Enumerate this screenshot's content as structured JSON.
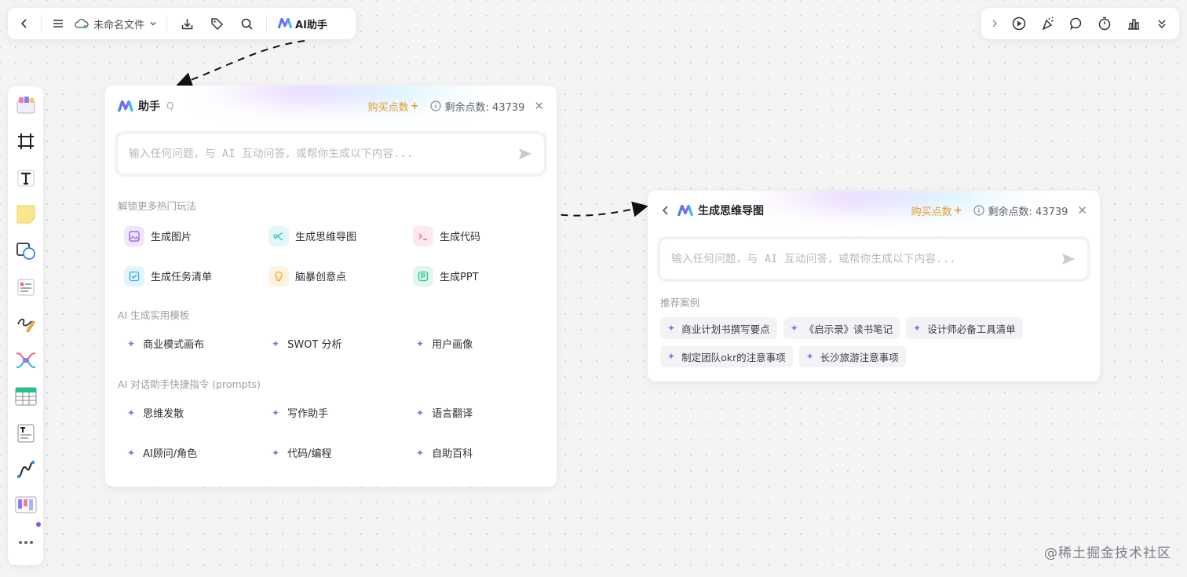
{
  "topbar": {
    "filename": "未命名文件",
    "ai_label": "AI助手"
  },
  "colors": {
    "accent": "#7b5cf0",
    "buy": "#e29a2e",
    "mindmap": "#1fc5c5",
    "code": "#f06292",
    "todo": "#2ab0e8",
    "idea": "#f5a623",
    "ppt": "#22c58b",
    "image": "#9b6bf2"
  },
  "assistant": {
    "title": "助手",
    "q": "Q",
    "buy": "购买点数",
    "points_label": "剩余点数: 43739",
    "placeholder": "输入任何问题，与 AI 互动问答，或帮你生成以下内容...",
    "section_unlock": "解锁更多热门玩法",
    "features": [
      {
        "label": "生成图片",
        "icon": "image-icon"
      },
      {
        "label": "生成思维导图",
        "icon": "mindmap-icon"
      },
      {
        "label": "生成代码",
        "icon": "code-icon"
      },
      {
        "label": "生成任务清单",
        "icon": "checklist-icon"
      },
      {
        "label": "脑暴创意点",
        "icon": "bulb-icon"
      },
      {
        "label": "生成PPT",
        "icon": "ppt-icon"
      }
    ],
    "section_templates": "AI 生成实用模板",
    "templates": [
      "商业模式画布",
      "SWOT 分析",
      "用户画像"
    ],
    "section_prompts": "AI 对话助手快捷指令 (prompts)",
    "prompts": [
      "思维发散",
      "写作助手",
      "语言翻译",
      "AI顾问/角色",
      "代码/编程",
      "自助百科"
    ]
  },
  "mindmap": {
    "title": "生成思维导图",
    "buy": "购买点数",
    "points_label": "剩余点数: 43739",
    "placeholder": "输入任何问题，与 AI 互动问答，或帮你生成以下内容...",
    "section_examples": "推荐案例",
    "examples": [
      "商业计划书撰写要点",
      "《启示录》读书笔记",
      "设计师必备工具清单",
      "制定团队okr的注意事项",
      "长沙旅游注意事项"
    ]
  },
  "watermark": "@稀土掘金技术社区"
}
